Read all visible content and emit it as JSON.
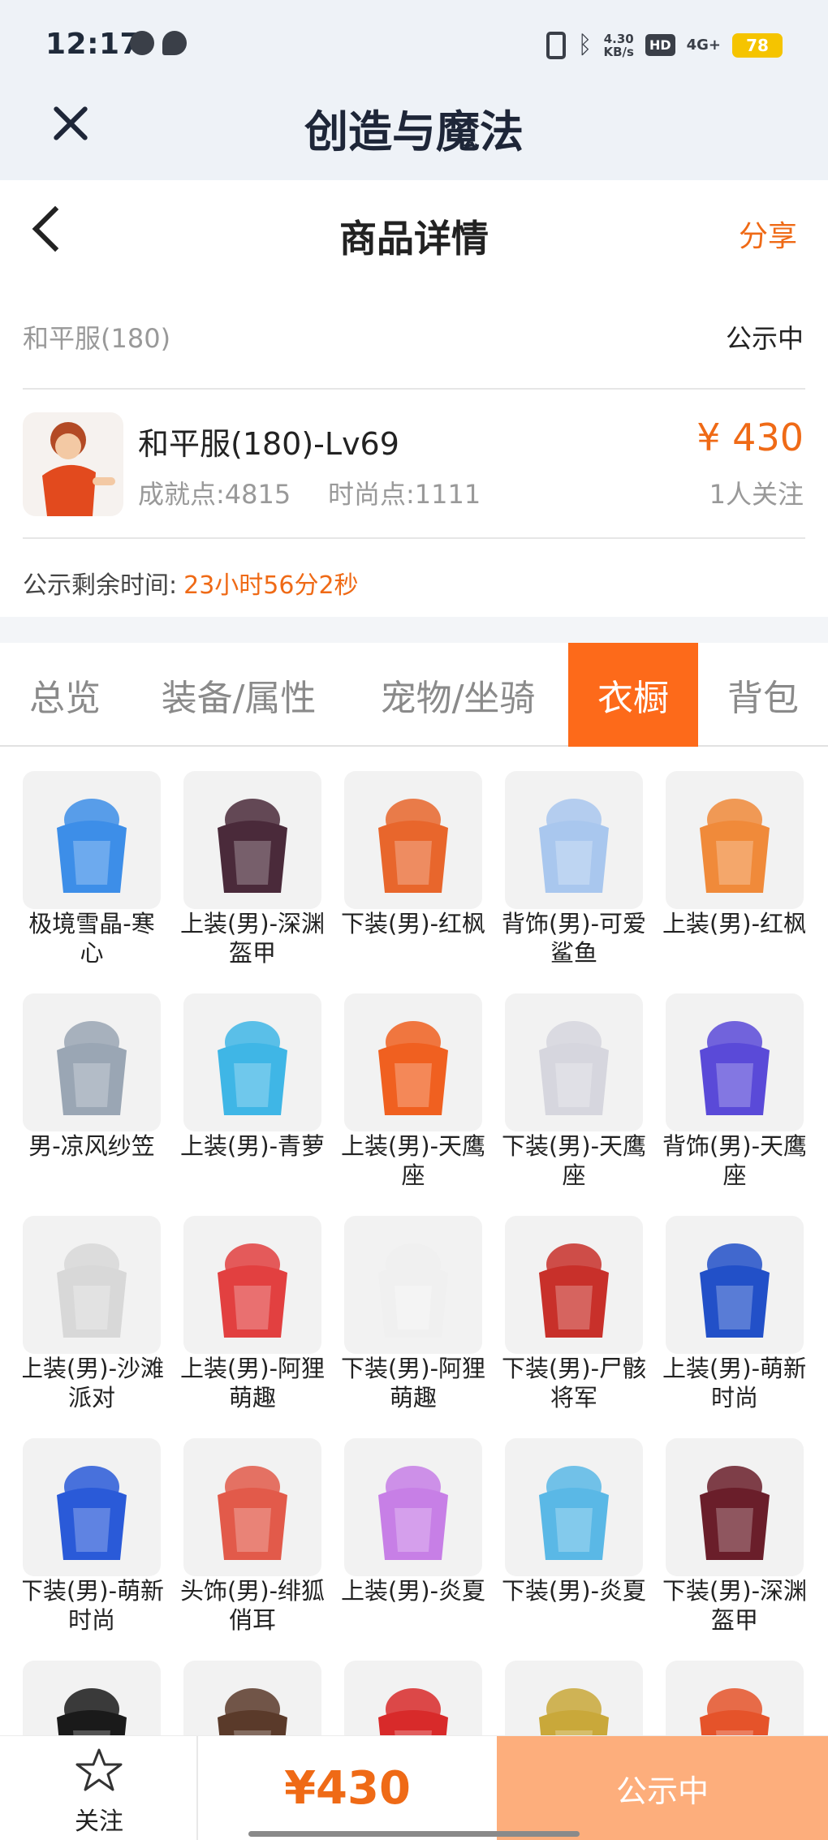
{
  "status_bar": {
    "time": "12:17",
    "net_speed_top": "4.30",
    "net_speed_unit": "KB/s",
    "hd": "HD",
    "signal": "4G+",
    "battery": "78"
  },
  "app": {
    "title": "创造与魔法"
  },
  "page": {
    "title": "商品详情",
    "share": "分享"
  },
  "listing": {
    "server": "和平服(180)",
    "status": "公示中",
    "name": "和平服(180)-Lv69",
    "achievement": "成就点:4815",
    "fashion": "时尚点:1111",
    "price": "¥ 430",
    "followers": "1人关注",
    "remain_label": "公示剩余时间:",
    "remain_value": "23小时56分2秒"
  },
  "tabs": [
    {
      "label": "总览",
      "active": false
    },
    {
      "label": "装备/属性",
      "active": false
    },
    {
      "label": "宠物/坐骑",
      "active": false
    },
    {
      "label": "衣橱",
      "active": true
    },
    {
      "label": "背包",
      "active": false
    }
  ],
  "wardrobe": [
    {
      "label": "极境雪晶-寒心",
      "icon": "ice-sword-icon",
      "color": "#3d8ee8"
    },
    {
      "label": "上装(男)-深渊盔甲",
      "icon": "dark-armor-icon",
      "color": "#4a2a3a"
    },
    {
      "label": "下装(男)-红枫",
      "icon": "maple-pants-icon",
      "color": "#e8662c"
    },
    {
      "label": "背饰(男)-可爱鲨鱼",
      "icon": "shark-backpack-icon",
      "color": "#a9c7ee"
    },
    {
      "label": "上装(男)-红枫",
      "icon": "maple-robe-icon",
      "color": "#f08a3a"
    },
    {
      "label": "男-凉风纱笠",
      "icon": "veil-hat-icon",
      "color": "#9aa6b4"
    },
    {
      "label": "上装(男)-青萝",
      "icon": "blue-robe-icon",
      "color": "#3fb6e6"
    },
    {
      "label": "上装(男)-天鹰座",
      "icon": "aquila-jacket-icon",
      "color": "#f06020"
    },
    {
      "label": "下装(男)-天鹰座",
      "icon": "aquila-pants-icon",
      "color": "#d6d6de"
    },
    {
      "label": "背饰(男)-天鹰座",
      "icon": "aquila-helmet-icon",
      "color": "#5a4ad8"
    },
    {
      "label": "上装(男)-沙滩派对",
      "icon": "beach-hoodie-icon",
      "color": "#d8d8d8"
    },
    {
      "label": "上装(男)-阿狸萌趣",
      "icon": "fox-jacket-icon",
      "color": "#e24040"
    },
    {
      "label": "下装(男)-阿狸萌趣",
      "icon": "fox-pants-icon",
      "color": "#f0f0f0"
    },
    {
      "label": "下装(男)-尸骸将军",
      "icon": "general-skirt-icon",
      "color": "#c8302a"
    },
    {
      "label": "上装(男)-萌新时尚",
      "icon": "fashion-top-icon",
      "color": "#2250c8"
    },
    {
      "label": "下装(男)-萌新时尚",
      "icon": "fashion-pants-icon",
      "color": "#2a5ad8"
    },
    {
      "label": "头饰(男)-绯狐俏耳",
      "icon": "fox-ears-icon",
      "color": "#e25a4a"
    },
    {
      "label": "上装(男)-炎夏",
      "icon": "lei-shirt-icon",
      "color": "#c77fe6"
    },
    {
      "label": "下装(男)-炎夏",
      "icon": "summer-shorts-icon",
      "color": "#5ab8e6"
    },
    {
      "label": "下装(男)-深渊盔甲",
      "icon": "abyss-pants-icon",
      "color": "#6a1e2a"
    },
    {
      "label": "",
      "icon": "black-hair-icon",
      "color": "#1a1a1a"
    },
    {
      "label": "",
      "icon": "crown-helmet-icon",
      "color": "#5a3a2a"
    },
    {
      "label": "",
      "icon": "cat-hood-icon",
      "color": "#d82a2a"
    },
    {
      "label": "",
      "icon": "gold-helmet-icon",
      "color": "#c9a83a"
    },
    {
      "label": "",
      "icon": "red-jacket-icon",
      "color": "#e5532a"
    }
  ],
  "bottom": {
    "follow_label": "关注",
    "price": "¥430",
    "status": "公示中"
  }
}
